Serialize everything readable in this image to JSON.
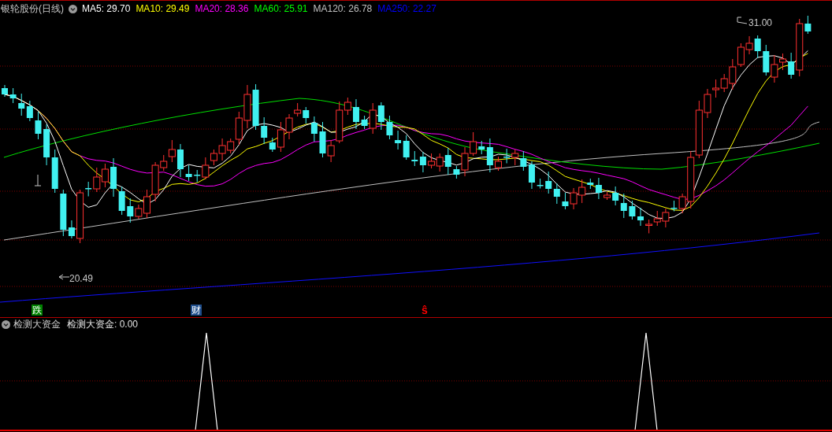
{
  "main_panel": {
    "stock_name": "银轮股份",
    "period": "(日线)",
    "moving_averages": [
      {
        "label": "MA5: 29.70",
        "color": "#ffffff"
      },
      {
        "label": "MA10: 29.49",
        "color": "#ffff00"
      },
      {
        "label": "MA20: 28.36",
        "color": "#ff00ff"
      },
      {
        "label": "MA60: 25.91",
        "color": "#00ff00"
      },
      {
        "label": "MA120: 26.78",
        "color": "#c0c0c0"
      },
      {
        "label": "MA250: 22.27",
        "color": "#0000ff"
      }
    ],
    "high_label": "31.00",
    "low_label": "20.49",
    "signals": [
      {
        "text": "跌",
        "color": "#008000"
      },
      {
        "text": "财",
        "color": "#1f4e8c"
      },
      {
        "text": "ŝ",
        "color": "#ff0000"
      }
    ]
  },
  "indicator_panel": {
    "name": "检测大资金",
    "readout": "检测大资金: 0.00"
  }
}
